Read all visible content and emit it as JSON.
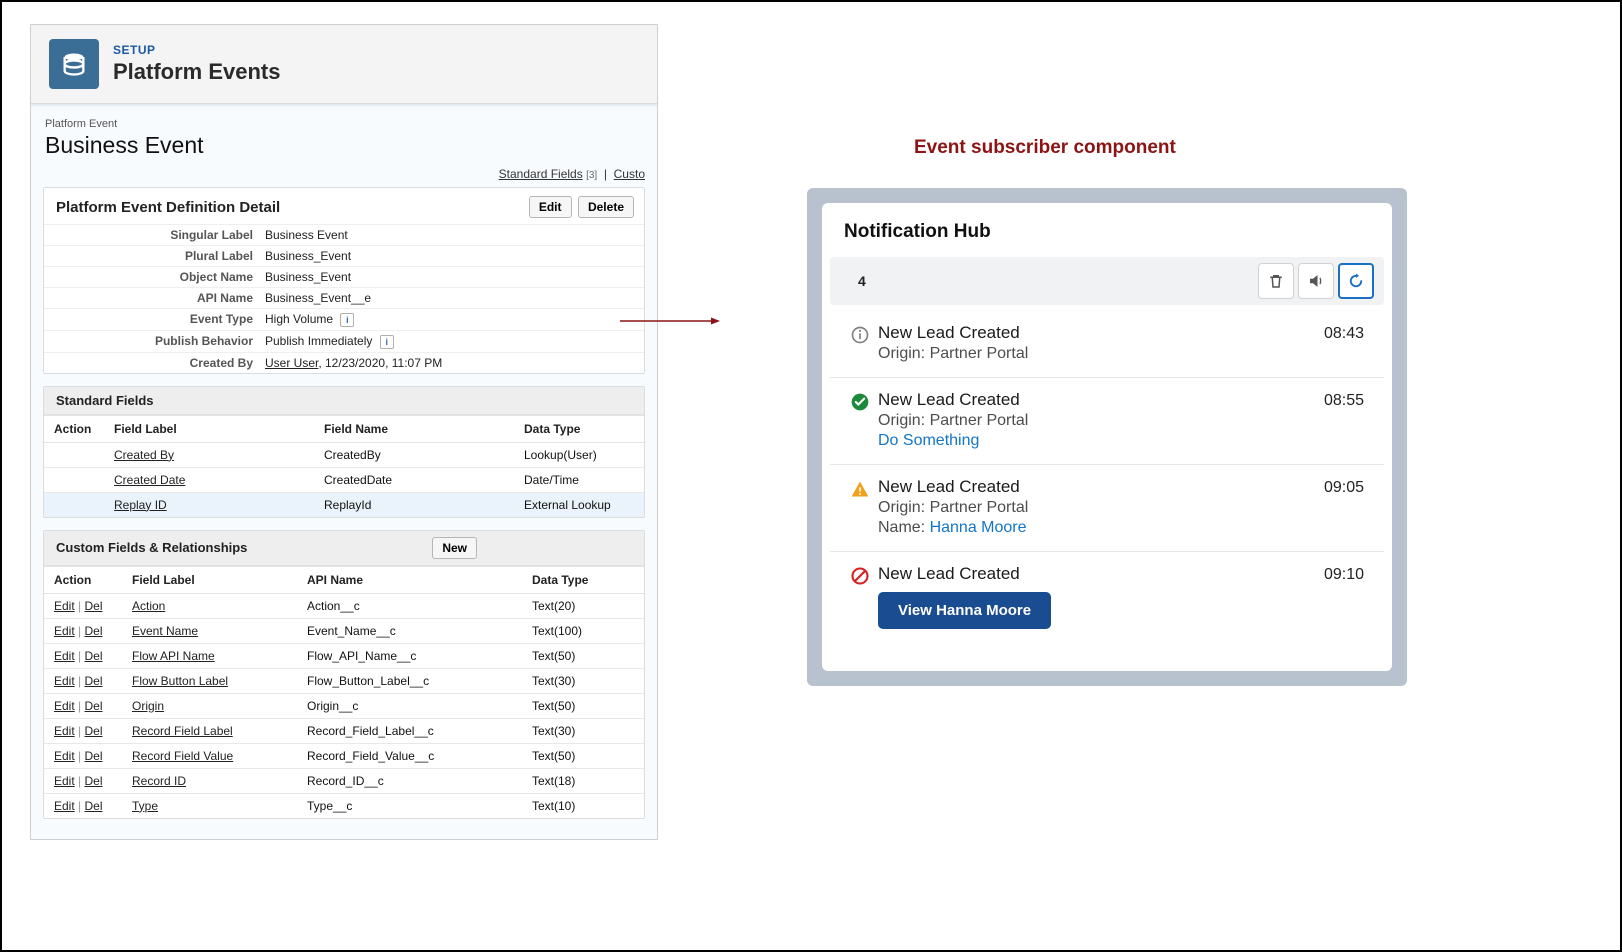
{
  "right_title": "Event subscriber component",
  "setup": {
    "breadcrumb": "SETUP",
    "title": "Platform Events"
  },
  "object": {
    "type": "Platform Event",
    "name": "Business Event",
    "links": {
      "std": "Standard Fields",
      "std_count": "[3]",
      "custom": "Custo"
    }
  },
  "definition": {
    "title": "Platform Event Definition Detail",
    "btn_edit": "Edit",
    "btn_delete": "Delete",
    "rows": [
      {
        "label": "Singular Label",
        "value": "Business Event"
      },
      {
        "label": "Plural Label",
        "value": "Business_Event"
      },
      {
        "label": "Object Name",
        "value": "Business_Event"
      },
      {
        "label": "API Name",
        "value": "Business_Event__e"
      },
      {
        "label": "Event Type",
        "value": "High Volume",
        "info": true
      },
      {
        "label": "Publish Behavior",
        "value": "Publish Immediately",
        "info": true
      },
      {
        "label": "Created By",
        "value_link": "User User",
        "value_after": ", 12/23/2020, 11:07 PM"
      }
    ]
  },
  "standard_fields": {
    "title": "Standard Fields",
    "cols": [
      "Action",
      "Field Label",
      "Field Name",
      "Data Type"
    ],
    "rows": [
      {
        "label": "Created By",
        "name": "CreatedBy",
        "type": "Lookup(User)"
      },
      {
        "label": "Created Date",
        "name": "CreatedDate",
        "type": "Date/Time"
      },
      {
        "label": "Replay ID",
        "name": "ReplayId",
        "type": "External Lookup",
        "hl": true
      }
    ]
  },
  "custom_fields": {
    "title": "Custom Fields & Relationships",
    "btn_new": "New",
    "cols": [
      "Action",
      "Field Label",
      "API Name",
      "Data Type"
    ],
    "action_edit": "Edit",
    "action_del": "Del",
    "rows": [
      {
        "label": "Action",
        "api": "Action__c",
        "type": "Text(20)"
      },
      {
        "label": "Event Name",
        "api": "Event_Name__c",
        "type": "Text(100)"
      },
      {
        "label": "Flow API Name",
        "api": "Flow_API_Name__c",
        "type": "Text(50)"
      },
      {
        "label": "Flow Button Label",
        "api": "Flow_Button_Label__c",
        "type": "Text(30)"
      },
      {
        "label": "Origin",
        "api": "Origin__c",
        "type": "Text(50)"
      },
      {
        "label": "Record Field Label",
        "api": "Record_Field_Label__c",
        "type": "Text(30)"
      },
      {
        "label": "Record Field Value",
        "api": "Record_Field_Value__c",
        "type": "Text(50)"
      },
      {
        "label": "Record ID",
        "api": "Record_ID__c",
        "type": "Text(18)"
      },
      {
        "label": "Type",
        "api": "Type__c",
        "type": "Text(10)"
      }
    ]
  },
  "hub": {
    "title": "Notification Hub",
    "count": "4",
    "items": [
      {
        "icon": "info",
        "title": "New Lead Created",
        "sub1": "Origin: Partner Portal",
        "time": "08:43"
      },
      {
        "icon": "check",
        "title": "New Lead Created",
        "sub1": "Origin: Partner Portal",
        "link": "Do Something",
        "time": "08:55"
      },
      {
        "icon": "warn",
        "title": "New Lead Created",
        "sub1": "Origin: Partner Portal",
        "sub2_label": "Name: ",
        "sub2_link": "Hanna Moore",
        "time": "09:05"
      },
      {
        "icon": "block",
        "title": "New Lead Created",
        "button": "View Hanna Moore",
        "time": "09:10"
      }
    ]
  }
}
